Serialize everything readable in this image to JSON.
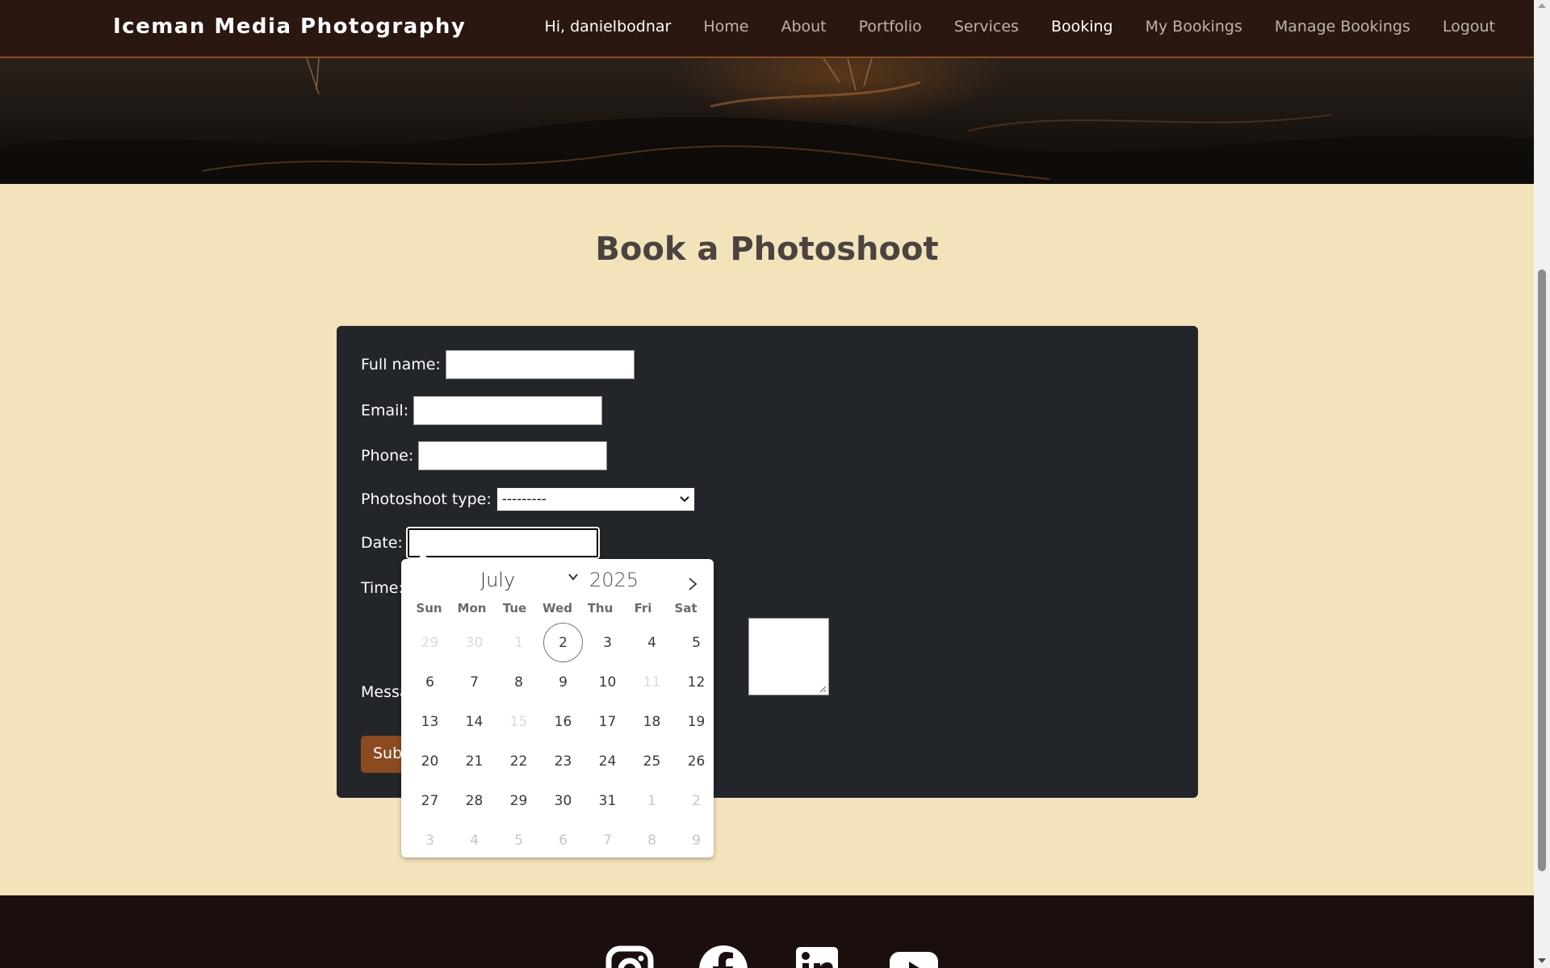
{
  "navbar": {
    "brand": "Iceman Media Photography",
    "links": [
      "Hi, danielbodnar",
      "Home",
      "About",
      "Portfolio",
      "Services",
      "Booking",
      "My Bookings",
      "Manage Bookings",
      "Logout"
    ],
    "active": "Booking"
  },
  "page": {
    "title": "Book a Photoshoot"
  },
  "form": {
    "full_name_label": "Full name:",
    "email_label": "Email:",
    "phone_label": "Phone:",
    "photoshoot_type_label": "Photoshoot type:",
    "photoshoot_type_value": "---------",
    "date_label": "Date:",
    "date_value": "",
    "time_label": "Time:",
    "message_label": "Messa",
    "submit_label": "Sub"
  },
  "calendar": {
    "month": "July",
    "year": "2025",
    "weekdays": [
      "Sun",
      "Mon",
      "Tue",
      "Wed",
      "Thu",
      "Fri",
      "Sat"
    ],
    "days": [
      {
        "d": "29",
        "s": "muted-disabled"
      },
      {
        "d": "30",
        "s": "muted-disabled"
      },
      {
        "d": "1",
        "s": "muted-disabled"
      },
      {
        "d": "2",
        "s": "today"
      },
      {
        "d": "3",
        "s": ""
      },
      {
        "d": "4",
        "s": ""
      },
      {
        "d": "5",
        "s": ""
      },
      {
        "d": "6",
        "s": ""
      },
      {
        "d": "7",
        "s": ""
      },
      {
        "d": "8",
        "s": ""
      },
      {
        "d": "9",
        "s": ""
      },
      {
        "d": "10",
        "s": ""
      },
      {
        "d": "11",
        "s": "disabled"
      },
      {
        "d": "12",
        "s": ""
      },
      {
        "d": "13",
        "s": ""
      },
      {
        "d": "14",
        "s": ""
      },
      {
        "d": "15",
        "s": "disabled"
      },
      {
        "d": "16",
        "s": ""
      },
      {
        "d": "17",
        "s": ""
      },
      {
        "d": "18",
        "s": ""
      },
      {
        "d": "19",
        "s": ""
      },
      {
        "d": "20",
        "s": ""
      },
      {
        "d": "21",
        "s": ""
      },
      {
        "d": "22",
        "s": ""
      },
      {
        "d": "23",
        "s": ""
      },
      {
        "d": "24",
        "s": ""
      },
      {
        "d": "25",
        "s": ""
      },
      {
        "d": "26",
        "s": ""
      },
      {
        "d": "27",
        "s": ""
      },
      {
        "d": "28",
        "s": ""
      },
      {
        "d": "29",
        "s": ""
      },
      {
        "d": "30",
        "s": ""
      },
      {
        "d": "31",
        "s": ""
      },
      {
        "d": "1",
        "s": "muted"
      },
      {
        "d": "2",
        "s": "muted"
      },
      {
        "d": "3",
        "s": "muted"
      },
      {
        "d": "4",
        "s": "muted"
      },
      {
        "d": "5",
        "s": "muted"
      },
      {
        "d": "6",
        "s": "muted"
      },
      {
        "d": "7",
        "s": "muted"
      },
      {
        "d": "8",
        "s": "muted"
      },
      {
        "d": "9",
        "s": "muted"
      }
    ],
    "today": "2"
  },
  "footer": {
    "social_icons": [
      "instagram-icon",
      "facebook-icon",
      "linkedin-icon",
      "youtube-icon"
    ]
  },
  "colors": {
    "navbar_bg": "#2a1710",
    "page_bg": "#f3e3bb",
    "card_bg": "#22252a",
    "accent": "#8b4a1f",
    "footer_bg": "#1b0f0e"
  }
}
